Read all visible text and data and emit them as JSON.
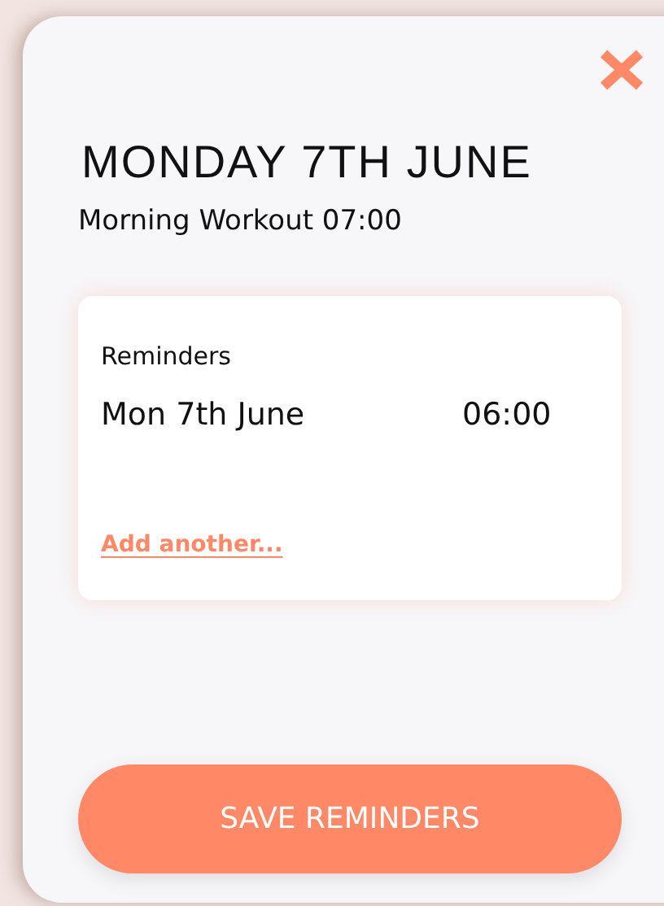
{
  "dialog": {
    "title": "MONDAY 7TH JUNE",
    "subtitle": "Morning Workout 07:00"
  },
  "reminders": {
    "heading": "Reminders",
    "items": [
      {
        "date": "Mon 7th June",
        "time": "06:00"
      }
    ],
    "add_link": "Add another..."
  },
  "save_button": "SAVE REMINDERS"
}
